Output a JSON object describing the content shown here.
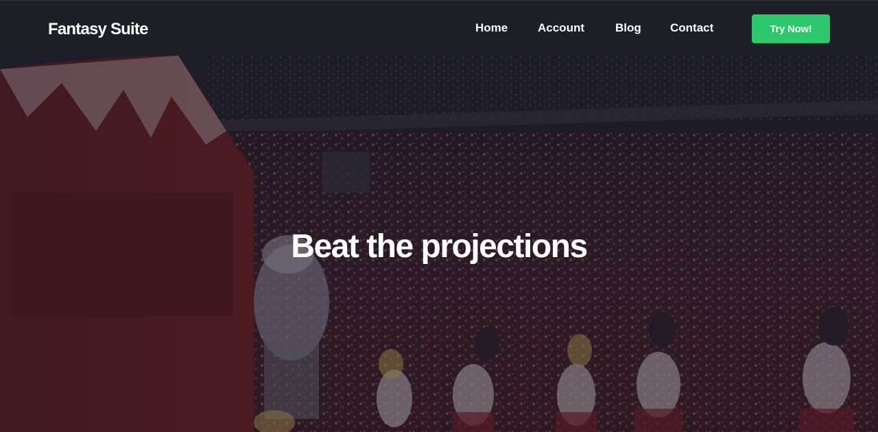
{
  "navbar": {
    "brand": "Fantasy Suite",
    "links": [
      {
        "label": "Home"
      },
      {
        "label": "Account"
      },
      {
        "label": "Blog"
      },
      {
        "label": "Contact"
      }
    ],
    "cta_label": "Try Now!"
  },
  "hero": {
    "title": "Beat the projections"
  },
  "colors": {
    "navbar_bg": "#1c1f26",
    "cta_bg": "#2dc76d",
    "text": "#ffffff"
  }
}
